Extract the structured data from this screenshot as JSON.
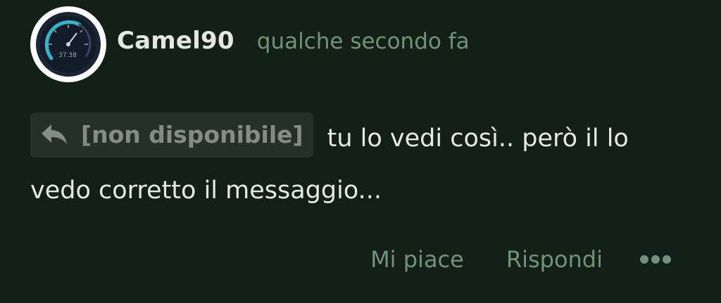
{
  "comment": {
    "author": "Camel90",
    "timestamp": "qualche secondo fa",
    "avatar_icon": "speedometer-icon",
    "avatar_text": "37.38",
    "reply_reference": {
      "icon": "reply-arrow-icon",
      "label": "[non disponibile]"
    },
    "message": "tu lo vedi così.. però il lo vedo corretto il messaggio..."
  },
  "actions": {
    "like_label": "Mi piace",
    "reply_label": "Rispondi",
    "more_icon": "more-dots-icon"
  },
  "colors": {
    "background": "#151f19",
    "accent": "#6f9477",
    "chip_background": "#26302b"
  }
}
